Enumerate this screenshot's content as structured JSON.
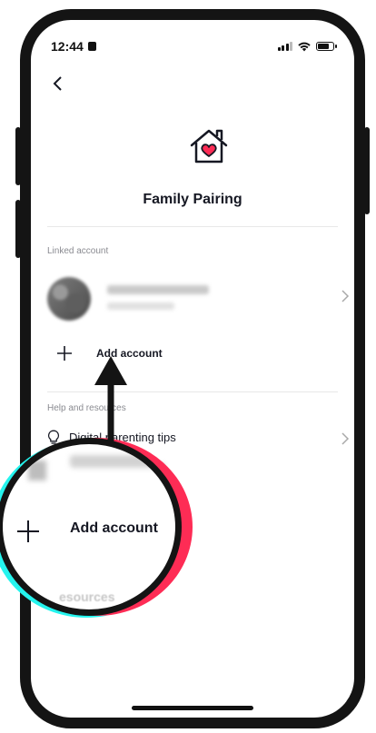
{
  "status_bar": {
    "time": "12:44"
  },
  "header": {
    "title": "Family Pairing"
  },
  "linked_section": {
    "label": "Linked account",
    "add_account_label": "Add account"
  },
  "help_section": {
    "label": "Help and resources",
    "tips_label": "Digital parenting tips"
  },
  "callout": {
    "label": "Add account",
    "faded_text": "esources"
  },
  "colors": {
    "accent_pink": "#fe2c55",
    "accent_cyan": "#25f4ee",
    "frame": "#141414"
  },
  "icons": {
    "back": "chevron-left-icon",
    "house": "house-heart-icon",
    "plus": "plus-icon",
    "tips": "lightbulb-icon",
    "chevron": "chevron-right-icon"
  }
}
